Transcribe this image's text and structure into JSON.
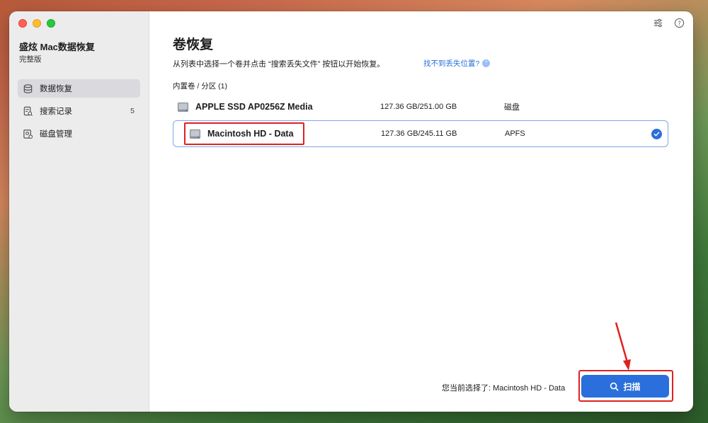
{
  "app": {
    "title": "盛炫 Mac数据恢复",
    "edition": "完整版"
  },
  "sidebar": {
    "items": [
      {
        "label": "数据恢复",
        "icon": "data-recovery-icon",
        "active": true
      },
      {
        "label": "搜索记录",
        "icon": "search-history-icon",
        "badge": "5"
      },
      {
        "label": "磁盘管理",
        "icon": "disk-management-icon"
      }
    ]
  },
  "toolbar": {
    "icons": [
      "settings-sliders-icon",
      "help-icon"
    ]
  },
  "main": {
    "title": "卷恢复",
    "instruction": "从列表中选择一个卷并点击 “搜索丢失文件” 按钮以开始恢复。",
    "help_link": "找不到丢失位置?",
    "section_label": "内置卷 / 分区 (1)",
    "volumes": [
      {
        "name": "APPLE SSD AP0256Z Media",
        "size": "127.36 GB/251.00 GB",
        "type": "磁盘",
        "selected": false
      },
      {
        "name": "Macintosh HD - Data",
        "size": "127.36 GB/245.11 GB",
        "type": "APFS",
        "selected": true
      }
    ]
  },
  "footer": {
    "selected_text": "您当前选择了: Macintosh HD - Data",
    "scan_label": "扫描"
  },
  "colors": {
    "accent": "#2a6fdb",
    "annotation": "#e02020"
  }
}
